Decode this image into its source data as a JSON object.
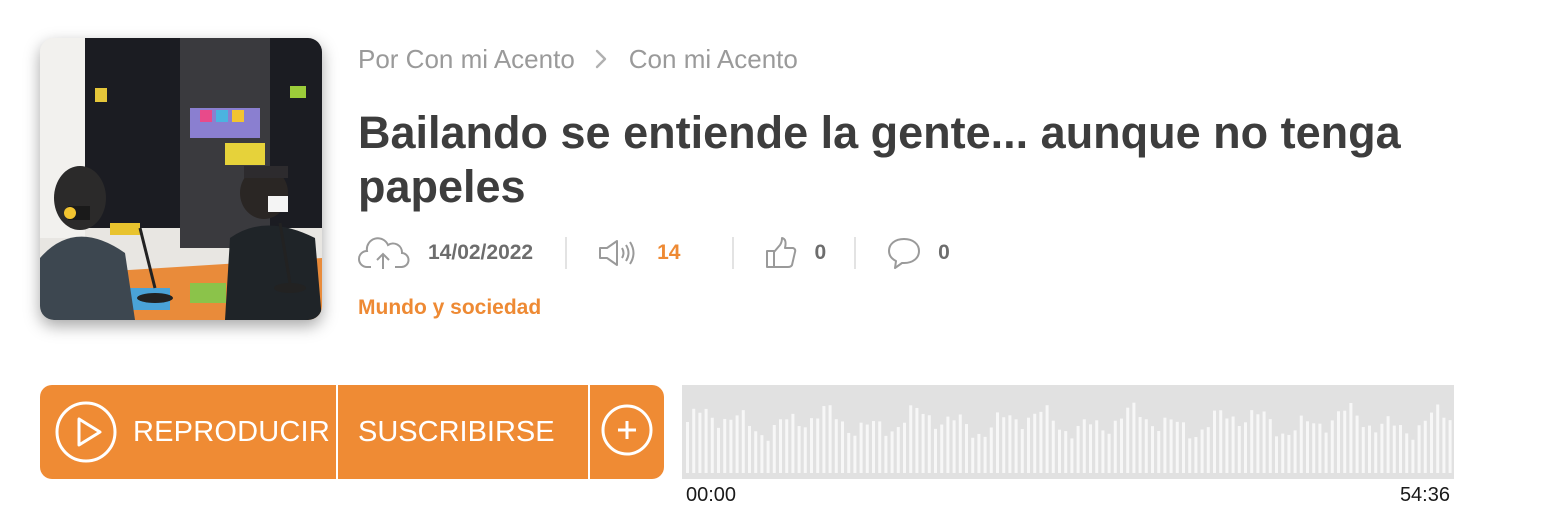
{
  "breadcrumb": {
    "by_label": "Por Con mi Acento",
    "program": "Con mi Acento"
  },
  "episode": {
    "title": "Bailando se entiende la gente... aunque no tenga papeles",
    "category": "Mundo y sociedad"
  },
  "stats": {
    "date": "14/02/2022",
    "plays": "14",
    "likes": "0",
    "comments": "0"
  },
  "player": {
    "play_label": "REPRODUCIR",
    "subscribe_label": "SUSCRIBIRSE",
    "elapsed": "00:00",
    "duration": "54:36"
  },
  "icons": {
    "upload": "cloud-upload-icon",
    "plays": "speaker-icon",
    "likes": "thumbs-up-icon",
    "comments": "speech-bubble-icon",
    "separator": "chevron-right-icon",
    "play": "play-circle-icon",
    "add": "plus-circle-icon"
  },
  "colors": {
    "accent": "#ef8b34",
    "title": "#3d3d3d",
    "muted": "#9a9a9a",
    "waveform_bg": "#e1e1e1"
  }
}
